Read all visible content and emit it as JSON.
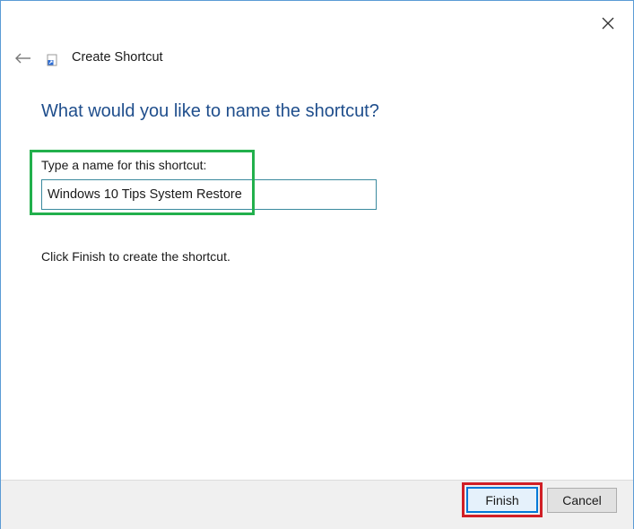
{
  "header": {
    "title": "Create Shortcut",
    "back_icon": "back-arrow-icon",
    "app_icon": "shortcut-icon",
    "close_icon": "close-icon"
  },
  "main": {
    "heading": "What would you like to name the shortcut?",
    "name_field": {
      "label": "Type a name for this shortcut:",
      "value": "Windows 10 Tips System Restore"
    },
    "info": "Click Finish to create the shortcut."
  },
  "footer": {
    "finish_label": "Finish",
    "cancel_label": "Cancel"
  },
  "colors": {
    "heading": "#1f4e8c",
    "accent": "#0078d7",
    "annotation_green": "#22b04c",
    "annotation_red": "#d01f26"
  }
}
